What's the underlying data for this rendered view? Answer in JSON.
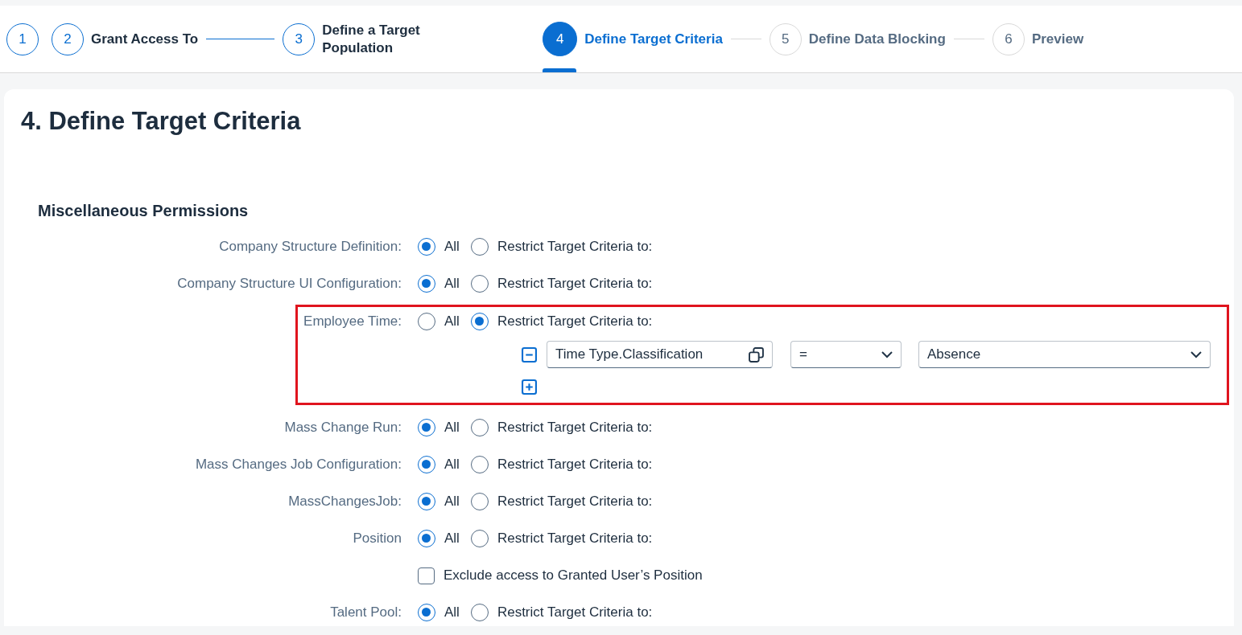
{
  "wizard": {
    "steps": [
      {
        "number": "1",
        "completed": true,
        "selected": false,
        "line_after": false
      },
      {
        "number": "2",
        "label": "Grant Access To",
        "completed": true,
        "selected": false,
        "line_after": true
      },
      {
        "number": "3",
        "label": "Define a Target Population",
        "completed": true,
        "selected": false,
        "line_after": false
      },
      {
        "number": "4",
        "label": "Define Target Criteria",
        "completed": false,
        "selected": true,
        "line_after": true
      },
      {
        "number": "5",
        "label": "Define Data Blocking",
        "completed": false,
        "selected": false,
        "line_after": true
      },
      {
        "number": "6",
        "label": "Preview",
        "completed": false,
        "selected": false,
        "line_after": false
      }
    ]
  },
  "page_title": "4. Define Target Criteria",
  "section": {
    "heading": "Miscellaneous Permissions",
    "rows": [
      {
        "kind": "radio",
        "label": "Company Structure Definition:",
        "options": [
          {
            "label": "All",
            "selected": true
          },
          {
            "label": "Restrict Target Criteria to:",
            "selected": false
          }
        ]
      },
      {
        "kind": "radio",
        "label": "Company Structure UI Configuration:",
        "options": [
          {
            "label": "All",
            "selected": true
          },
          {
            "label": "Restrict Target Criteria to:",
            "selected": false
          }
        ]
      },
      {
        "kind": "radio",
        "label": "Employee Time:",
        "highlighted": true,
        "options": [
          {
            "label": "All",
            "selected": false
          },
          {
            "label": "Restrict Target Criteria to:",
            "selected": true
          }
        ],
        "criteria": [
          {
            "field": "Time Type.Classification",
            "operator": "=",
            "value": "Absence"
          }
        ]
      },
      {
        "kind": "radio",
        "label": "Mass Change Run:",
        "options": [
          {
            "label": "All",
            "selected": true
          },
          {
            "label": "Restrict Target Criteria to:",
            "selected": false
          }
        ]
      },
      {
        "kind": "radio",
        "label": "Mass Changes Job Configuration:",
        "options": [
          {
            "label": "All",
            "selected": true
          },
          {
            "label": "Restrict Target Criteria to:",
            "selected": false
          }
        ]
      },
      {
        "kind": "radio",
        "label": "MassChangesJob:",
        "options": [
          {
            "label": "All",
            "selected": true
          },
          {
            "label": "Restrict Target Criteria to:",
            "selected": false
          }
        ]
      },
      {
        "kind": "radio",
        "label": "Position",
        "options": [
          {
            "label": "All",
            "selected": true
          },
          {
            "label": "Restrict Target Criteria to:",
            "selected": false
          }
        ]
      },
      {
        "kind": "checkbox",
        "label": "Exclude access to Granted User’s Position",
        "checked": false
      },
      {
        "kind": "radio",
        "label": "Talent Pool:",
        "options": [
          {
            "label": "All",
            "selected": true
          },
          {
            "label": "Restrict Target Criteria to:",
            "selected": false
          }
        ]
      }
    ]
  }
}
